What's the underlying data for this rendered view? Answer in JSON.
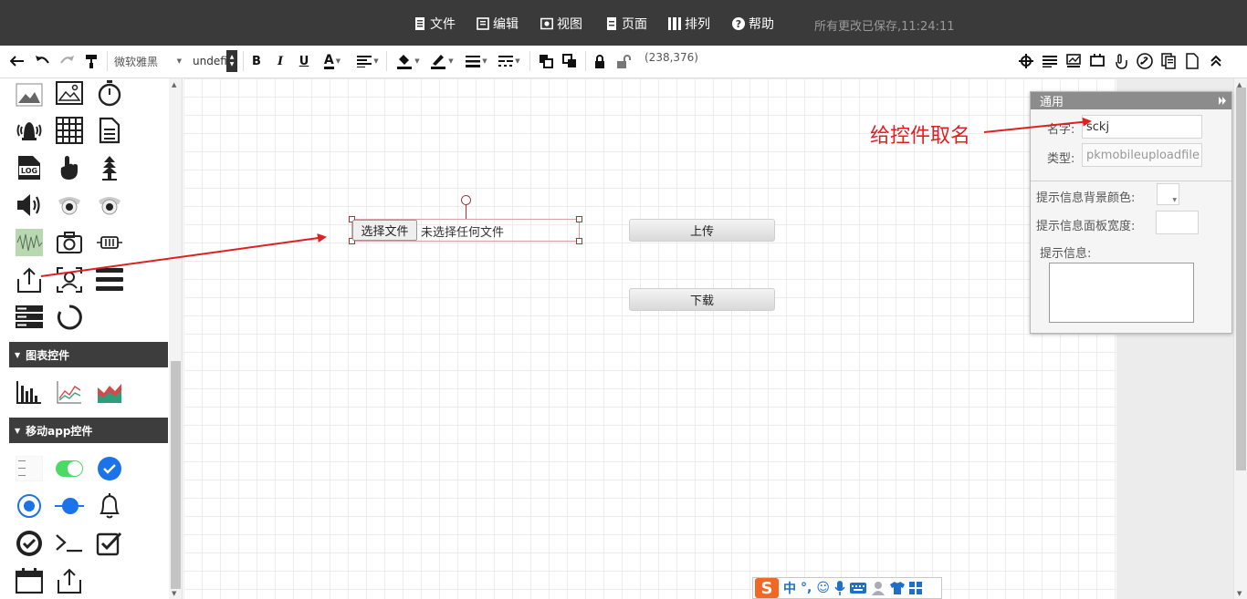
{
  "menu": {
    "items": [
      {
        "label": "文件",
        "icon": "file-icon"
      },
      {
        "label": "编辑",
        "icon": "edit-icon"
      },
      {
        "label": "视图",
        "icon": "eye-icon"
      },
      {
        "label": "页面",
        "icon": "page-icon"
      },
      {
        "label": "排列",
        "icon": "arrange-icon"
      },
      {
        "label": "帮助",
        "icon": "help-icon"
      }
    ],
    "save_status": "所有更改已保存,11:24:11"
  },
  "toolbar": {
    "font_family": "微软雅黑",
    "font_size": "undefined",
    "bold": "B",
    "italic": "I",
    "underline": "U",
    "font_color": "A",
    "coords": "(238,376)"
  },
  "sidebar": {
    "sections": [
      {
        "label": "图表控件"
      },
      {
        "label": "移动app控件"
      }
    ]
  },
  "canvas": {
    "choose_file_label": "选择文件",
    "no_file_label": "未选择任何文件",
    "upload_button": "上传",
    "download_button": "下载"
  },
  "annotation": {
    "text": "给控件取名",
    "color": "#e02020"
  },
  "prop_panel": {
    "title": "通用",
    "name_label": "名字:",
    "name_value": "sckj",
    "type_label": "类型:",
    "type_value": "pkmobileuploadfile",
    "bg_color_label": "提示信息背景颜色:",
    "width_label": "提示信息面板宽度:",
    "info_label": "提示信息:"
  },
  "ime": {
    "logo": "S",
    "lang": "中"
  }
}
